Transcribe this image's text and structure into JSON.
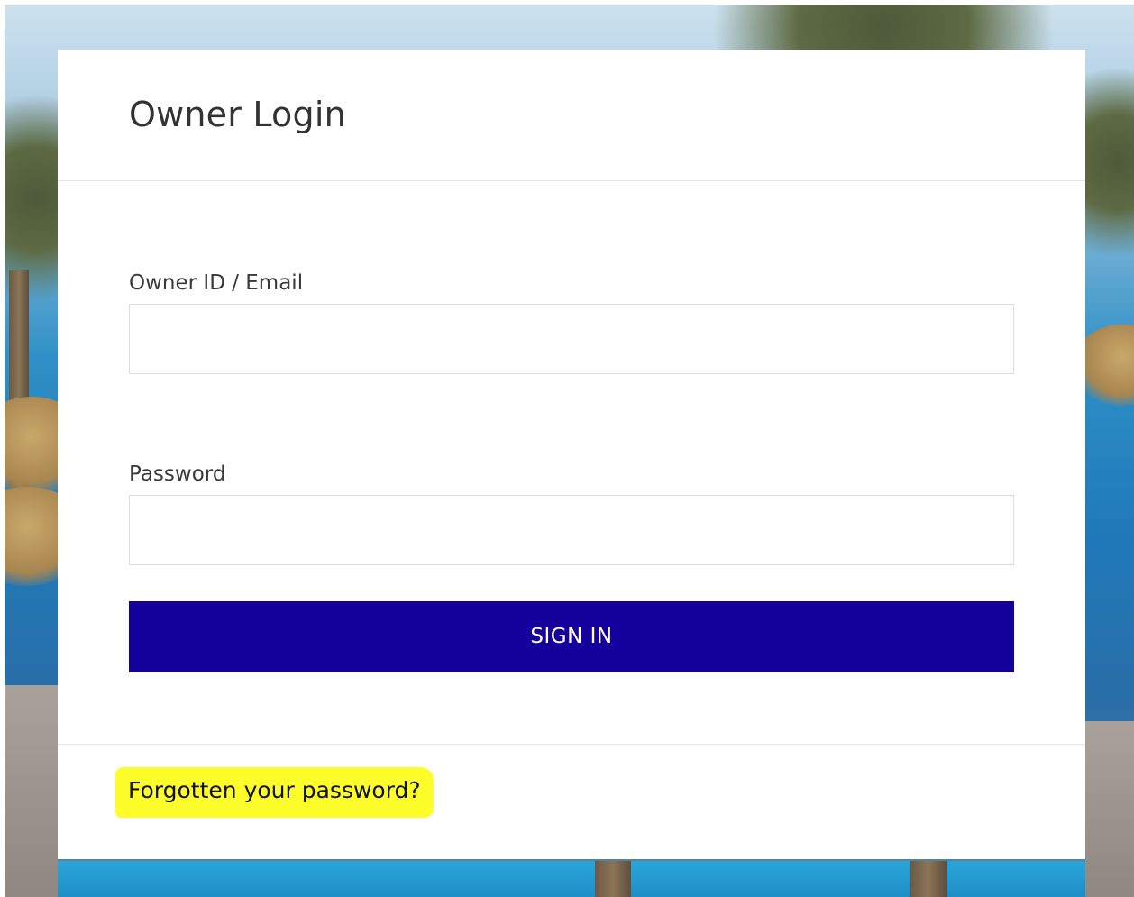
{
  "page": {
    "title": "Owner Login"
  },
  "form": {
    "owner_id_label": "Owner ID / Email",
    "owner_id_value": "",
    "password_label": "Password",
    "password_value": "",
    "sign_in_label": "SIGN IN"
  },
  "footer": {
    "forgot_password_link": "Forgotten your password?"
  },
  "colors": {
    "primary_button": "#14009a",
    "highlight": "#fdfd2a"
  }
}
